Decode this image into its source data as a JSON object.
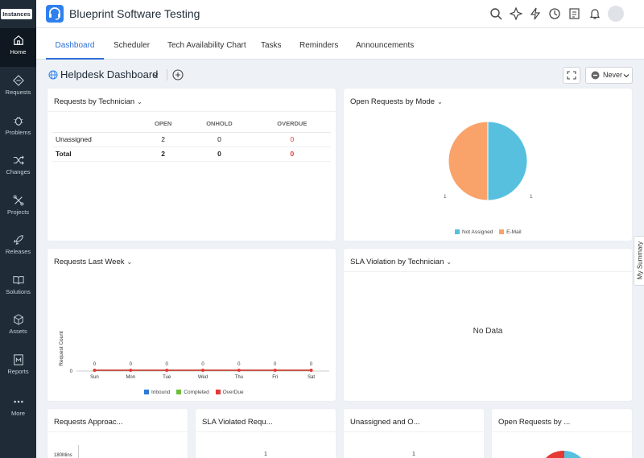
{
  "sidebar": {
    "instances_label": "Instances",
    "items": [
      {
        "label": "Home",
        "icon": "home-icon"
      },
      {
        "label": "Requests",
        "icon": "requests-icon"
      },
      {
        "label": "Problems",
        "icon": "bug-icon"
      },
      {
        "label": "Changes",
        "icon": "shuffle-icon"
      },
      {
        "label": "Projects",
        "icon": "projects-icon"
      },
      {
        "label": "Releases",
        "icon": "rocket-icon"
      },
      {
        "label": "Solutions",
        "icon": "book-icon"
      },
      {
        "label": "Assets",
        "icon": "cube-icon"
      },
      {
        "label": "Reports",
        "icon": "reports-icon"
      },
      {
        "label": "More",
        "icon": "more-icon"
      }
    ]
  },
  "header": {
    "app_title": "Blueprint Software Testing",
    "icons": [
      "search-icon",
      "ai-sparkle-icon",
      "lightning-icon",
      "history-icon",
      "notes-icon",
      "bell-icon",
      "gear-icon",
      "user-avatar"
    ]
  },
  "tabs": [
    "Dashboard",
    "Scheduler",
    "Tech Availability Chart",
    "Tasks",
    "Reminders",
    "Announcements"
  ],
  "dashboard": {
    "title": "Helpdesk Dashboard",
    "refresh_label": "Never"
  },
  "widgets": {
    "by_technician": {
      "title": "Requests by Technician",
      "columns": [
        "",
        "OPEN",
        "ONHOLD",
        "OVERDUE"
      ],
      "rows": [
        {
          "name": "Unassigned",
          "open": "2",
          "onhold": "0",
          "overdue": "0"
        },
        {
          "name": "Total",
          "open": "2",
          "onhold": "0",
          "overdue": "0"
        }
      ]
    },
    "by_mode": {
      "title": "Open Requests by Mode",
      "left_label": "1",
      "right_label": "1",
      "legend": [
        "Not Assigned",
        "E-Mail"
      ]
    },
    "last_week": {
      "title": "Requests Last Week",
      "ylabel": "Request Count",
      "zero_label": "0",
      "legend": [
        "Inbound",
        "Completed",
        "OverDue"
      ]
    },
    "sla_by_tech": {
      "title": "SLA Violation by Technician",
      "nodata": "No Data"
    },
    "approaching": {
      "title": "Requests Approac...",
      "tick": "180Mins"
    },
    "sla_violated": {
      "title": "SLA Violated Requ...",
      "value": "1"
    },
    "unassigned_open": {
      "title": "Unassigned and O...",
      "value": "1"
    },
    "open_by": {
      "title": "Open Requests by ..."
    }
  },
  "my_summary": "My Summary",
  "chart_data": [
    {
      "type": "pie",
      "title": "Open Requests by Mode",
      "series": [
        {
          "name": "Not Assigned",
          "value": 1,
          "color": "#56c0de"
        },
        {
          "name": "E-Mail",
          "value": 1,
          "color": "#f9a36b"
        }
      ],
      "legend": "bottom"
    },
    {
      "type": "line",
      "title": "Requests Last Week",
      "categories": [
        "Sun",
        "Mon",
        "Tue",
        "Wed",
        "Thu",
        "Fri",
        "Sat"
      ],
      "ylabel": "Request Count",
      "series": [
        {
          "name": "Inbound",
          "values": [
            0,
            0,
            0,
            0,
            0,
            0,
            0
          ],
          "color": "#2e7bd6"
        },
        {
          "name": "Completed",
          "values": [
            0,
            0,
            0,
            0,
            0,
            0,
            0
          ],
          "color": "#6cbf3c"
        },
        {
          "name": "OverDue",
          "values": [
            0,
            0,
            0,
            0,
            0,
            0,
            0
          ],
          "color": "#e53935"
        }
      ],
      "legend": "bottom"
    }
  ]
}
